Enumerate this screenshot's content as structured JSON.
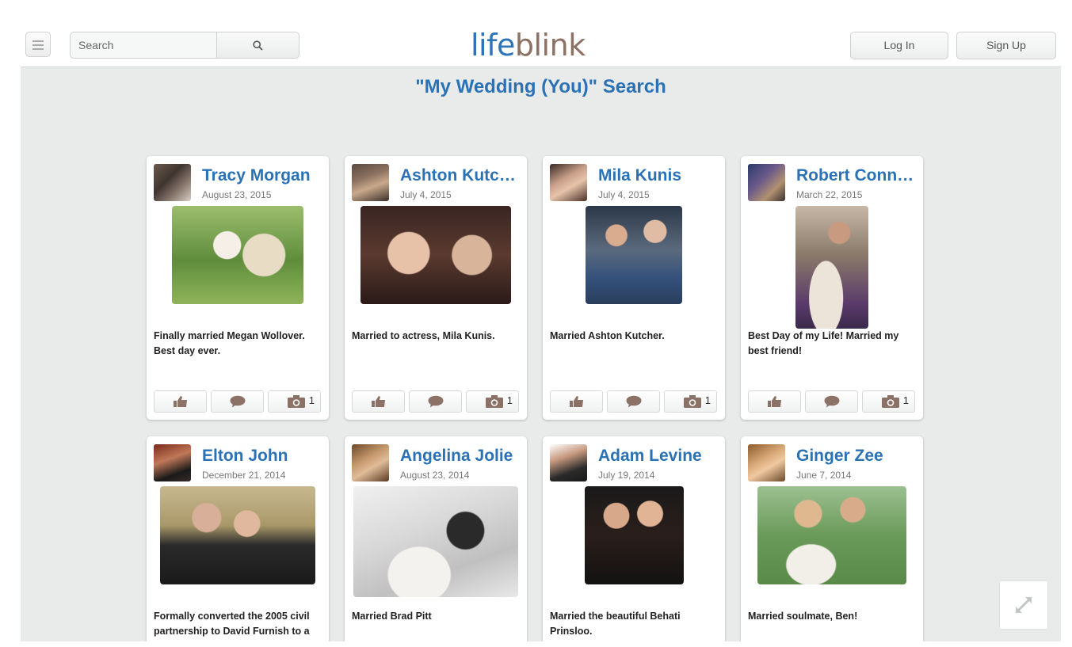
{
  "header": {
    "search_placeholder": "Search",
    "logo_part1": "life",
    "logo_part2": "blink",
    "login_label": "Log In",
    "signup_label": "Sign Up"
  },
  "page_title": "\"My Wedding (You)\" Search",
  "colors": {
    "link_blue": "#2a72b5",
    "logo_brown": "#8d7264",
    "background": "#e9ebeb"
  },
  "icons": [
    "menu-icon",
    "search-icon",
    "thumbs-up-icon",
    "comment-icon",
    "camera-icon",
    "expand-icon"
  ],
  "cards": [
    {
      "name": "Tracy Morgan",
      "date": "August 23, 2015",
      "caption": "Finally married Megan Wollover. Best day ever.",
      "photo_count": "1"
    },
    {
      "name": "Ashton Kutcher",
      "date": "July 4, 2015",
      "caption": "Married to actress, Mila Kunis.",
      "photo_count": "1"
    },
    {
      "name": "Mila Kunis",
      "date": "July 4, 2015",
      "caption": "Married Ashton Kutcher.",
      "photo_count": "1"
    },
    {
      "name": "Robert Connelly",
      "date": "March 22, 2015",
      "caption": "Best Day of my Life! Married my best friend!",
      "photo_count": "1"
    },
    {
      "name": "Elton John",
      "date": "December 21, 2014",
      "caption": "Formally converted the 2005 civil partnership to David Furnish to a",
      "photo_count": ""
    },
    {
      "name": "Angelina Jolie",
      "date": "August 23, 2014",
      "caption": "Married Brad Pitt",
      "photo_count": ""
    },
    {
      "name": "Adam Levine",
      "date": "July 19, 2014",
      "caption": "Married the beautiful Behati Prinsloo.",
      "photo_count": ""
    },
    {
      "name": "Ginger Zee",
      "date": "June 7, 2014",
      "caption": "Married soulmate, Ben!",
      "photo_count": ""
    }
  ]
}
